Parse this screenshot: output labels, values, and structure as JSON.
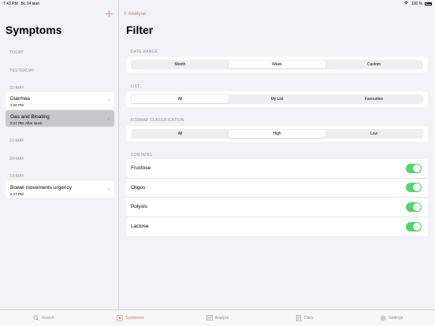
{
  "status": {
    "time": "7:43 PM",
    "date": "Вс 24 мая",
    "battery": "100 %"
  },
  "left": {
    "title": "Symptoms",
    "sections": [
      {
        "label": "TODAY",
        "items": []
      },
      {
        "label": "YESTERDAY",
        "items": []
      },
      {
        "label": "22-MAY",
        "items": [
          {
            "name": "Diarrhea",
            "sub": "2:20 PM",
            "selected": false
          },
          {
            "name": "Gas and Bloating",
            "sub": "2:17 PM, After lunch",
            "selected": true
          }
        ]
      },
      {
        "label": "21-MAY",
        "items": []
      },
      {
        "label": "20-MAY",
        "items": []
      },
      {
        "label": "19-MAY",
        "items": [
          {
            "name": "Bowel movements urgency",
            "sub": "2:17 PM",
            "selected": false
          }
        ]
      }
    ]
  },
  "right": {
    "back_label": "Analyse",
    "title": "Filter",
    "date_range": {
      "label": "DATE RANGE",
      "options": [
        "Month",
        "Week",
        "Custom"
      ],
      "selected": "Week"
    },
    "list": {
      "label": "LIST",
      "options": [
        "All",
        "My List",
        "Favourites"
      ],
      "selected": "All"
    },
    "fodmap": {
      "label": "FODMAP CLASSIFICATION",
      "options": [
        "All",
        "High",
        "Low"
      ],
      "selected": "High"
    },
    "contains": {
      "label": "CONTAINS",
      "items": [
        {
          "name": "Fructose",
          "on": true
        },
        {
          "name": "Oligos",
          "on": true
        },
        {
          "name": "Polyols",
          "on": true
        },
        {
          "name": "Lactose",
          "on": true
        }
      ]
    }
  },
  "tabs": [
    {
      "label": "Search",
      "icon": "search-icon",
      "active": false
    },
    {
      "label": "Symptoms",
      "icon": "symptoms-icon",
      "active": true
    },
    {
      "label": "Analyze",
      "icon": "analyze-icon",
      "active": false
    },
    {
      "label": "Diary",
      "icon": "diary-icon",
      "active": false
    },
    {
      "label": "Settings",
      "icon": "settings-icon",
      "active": false
    }
  ],
  "colors": {
    "accent": "#f2735f",
    "toggle_on": "#4cd964",
    "selected_row": "#c7c7cc",
    "background": "#f2f2f7"
  }
}
